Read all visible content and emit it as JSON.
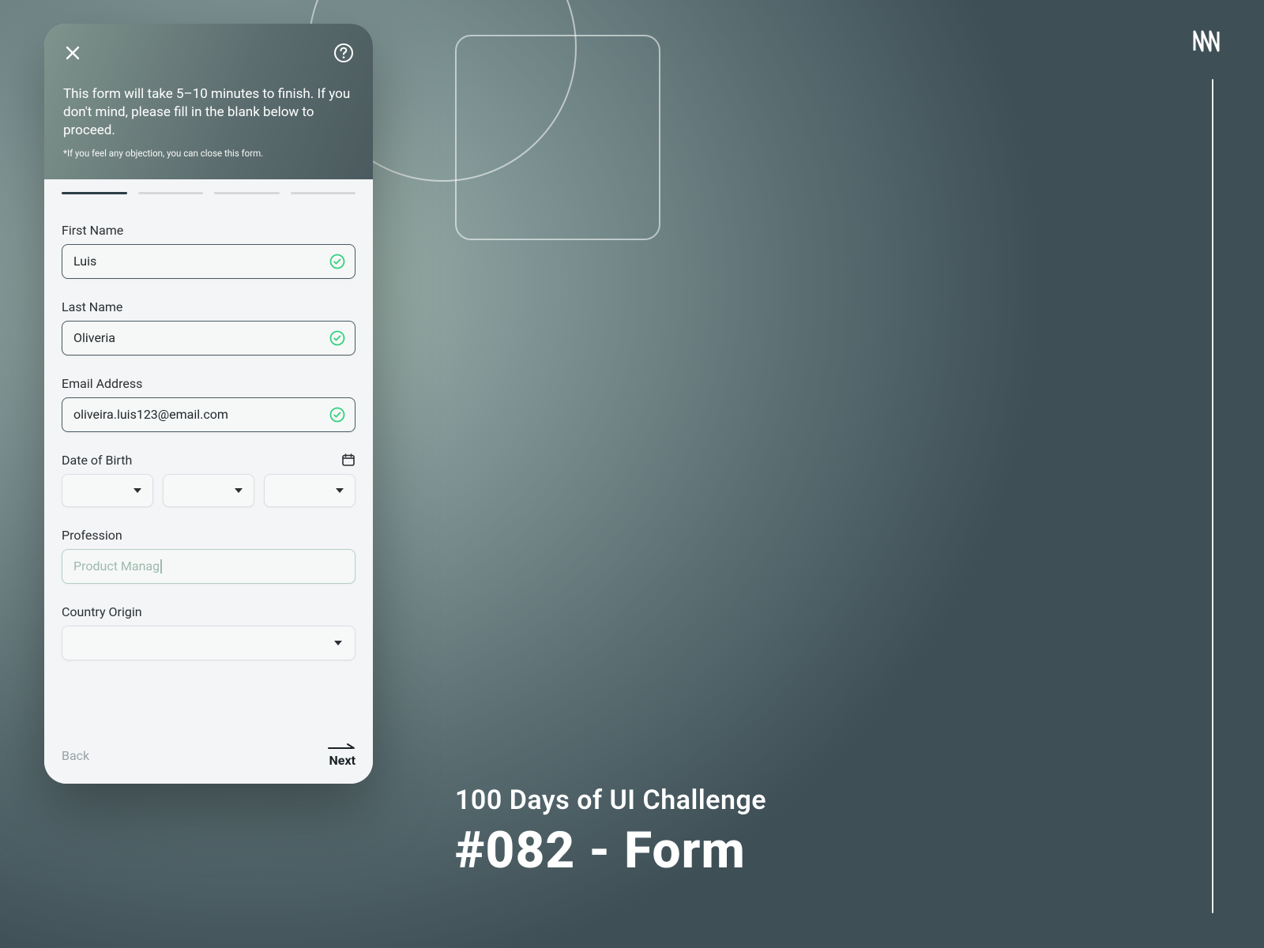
{
  "background_decor": {
    "challenge_line1": "100 Days of UI Challenge",
    "challenge_line2": "#082 - Form"
  },
  "header": {
    "intro": "This form will take 5–10 minutes to finish. If you don't mind, please fill in the blank below to proceed.",
    "note": "*If you feel any objection, you can close this form."
  },
  "stepper": {
    "total": 4,
    "active_index": 0
  },
  "fields": {
    "first_name": {
      "label": "First Name",
      "value": "Luis",
      "valid": true
    },
    "last_name": {
      "label": "Last Name",
      "value": "Oliveria",
      "valid": true
    },
    "email": {
      "label": "Email Address",
      "value": "oliveira.luis123@email.com",
      "valid": true
    },
    "dob": {
      "label": "Date of Birth",
      "day": "",
      "month": "",
      "year": ""
    },
    "profession": {
      "label": "Profession",
      "typing_value": "Product Manag"
    },
    "country": {
      "label": "Country Origin",
      "value": ""
    }
  },
  "nav": {
    "back": "Back",
    "next": "Next"
  },
  "colors": {
    "valid_green": "#34d17c",
    "border_dark": "#4a5a60"
  }
}
